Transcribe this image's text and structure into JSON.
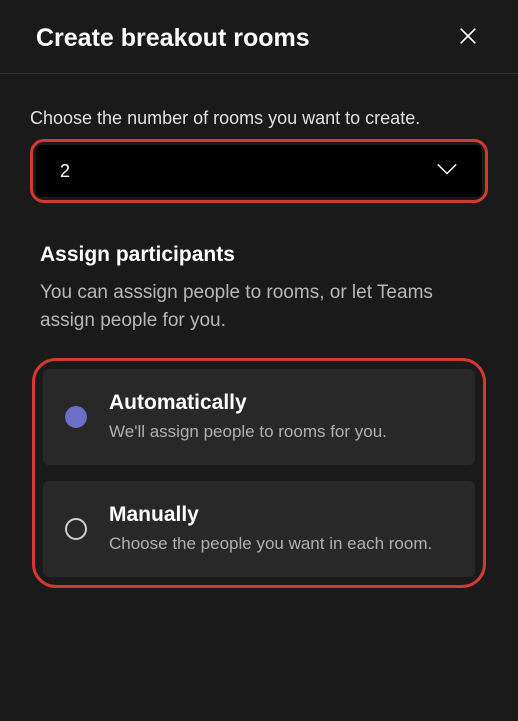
{
  "header": {
    "title": "Create breakout rooms"
  },
  "choose": {
    "label": "Choose the number of rooms you want to create.",
    "selected": "2"
  },
  "assign": {
    "heading": "Assign participants",
    "description": "You can asssign people to rooms, or let Teams assign people for you."
  },
  "options": {
    "auto": {
      "title": "Automatically",
      "desc": "We'll assign people to rooms for you."
    },
    "manual": {
      "title": "Manually",
      "desc": "Choose the people you want in each room."
    }
  }
}
